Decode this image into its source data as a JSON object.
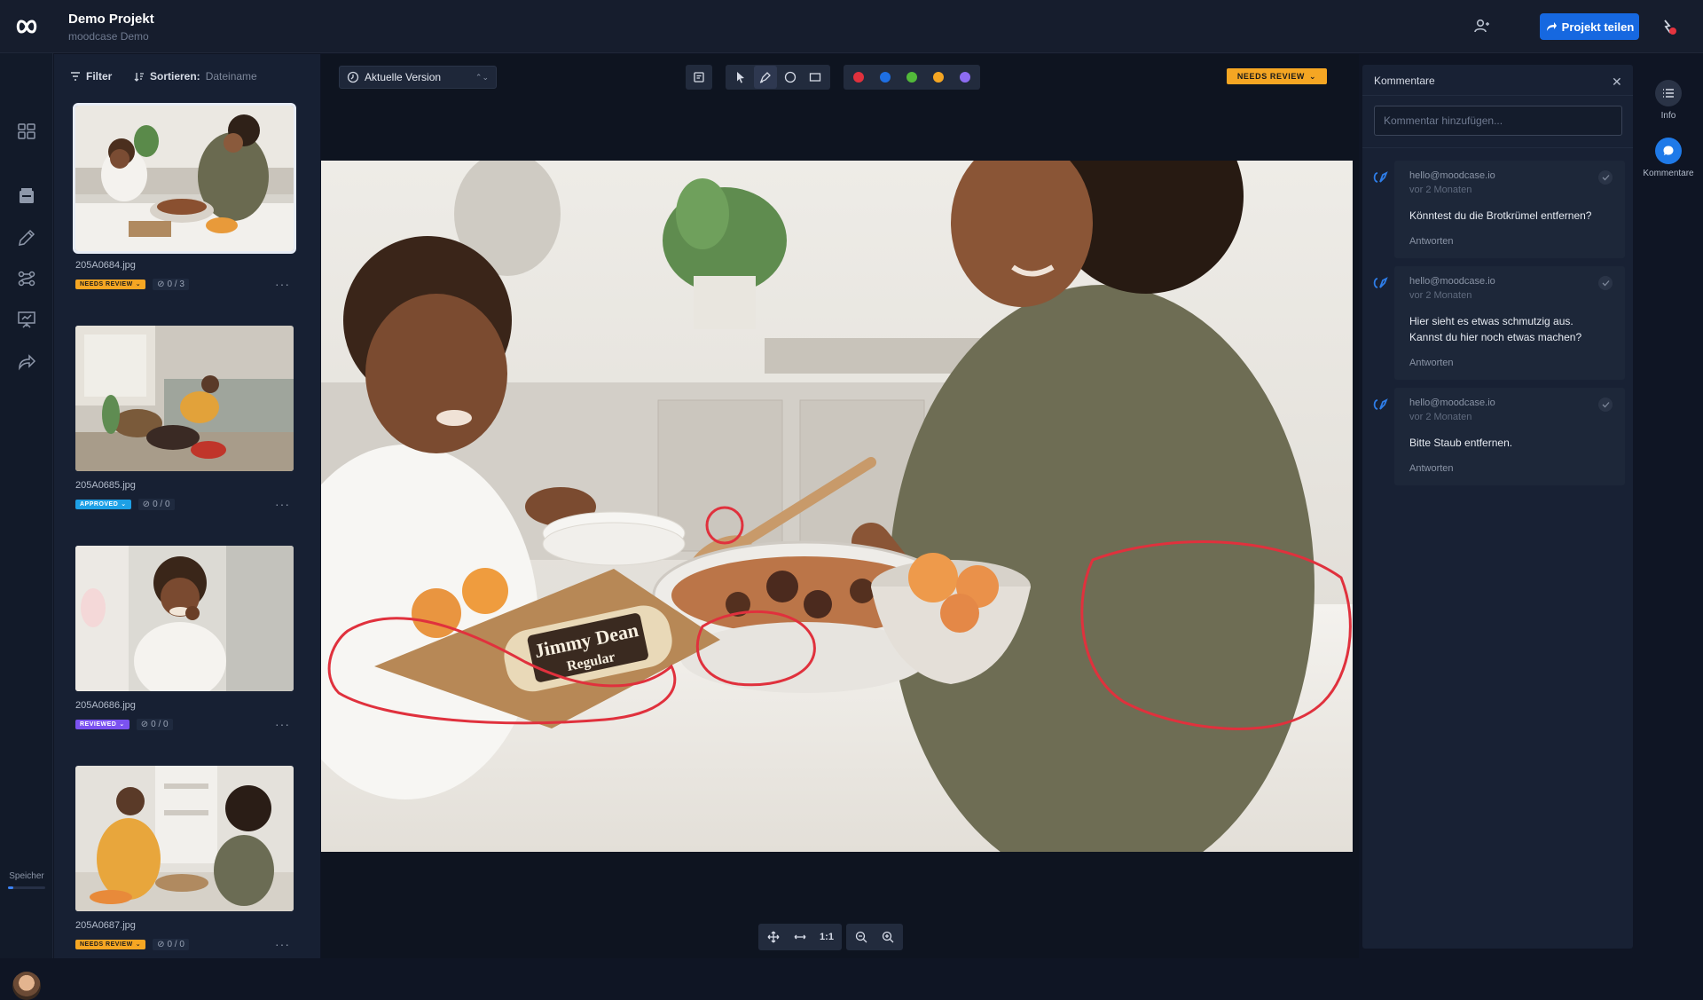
{
  "app": {
    "project_title": "Demo Projekt",
    "project_subtitle": "moodcase Demo",
    "share_label": "Projekt teilen"
  },
  "sidebar": {
    "storage_label": "Speicher",
    "storage_used_fraction": 0.15
  },
  "thumbs": {
    "filter_label": "Filter",
    "sort_label": "Sortieren:",
    "sort_value": "Dateiname",
    "items": [
      {
        "name": "205A0684.jpg",
        "status": "NEEDS REVIEW",
        "count": "0 / 3",
        "selected": true
      },
      {
        "name": "205A0685.jpg",
        "status": "APPROVED",
        "count": "0 / 0",
        "selected": false
      },
      {
        "name": "205A0686.jpg",
        "status": "REVIEWED",
        "count": "0 / 0",
        "selected": false
      },
      {
        "name": "205A0687.jpg",
        "status": "NEEDS REVIEW",
        "count": "0 / 0",
        "selected": false
      }
    ],
    "more_label": "···"
  },
  "viewer": {
    "version_label": "Aktuelle Version",
    "status_label": "NEEDS REVIEW",
    "colors": [
      "#e0313d",
      "#1e6fe3",
      "#52b93a",
      "#f5a623",
      "#8d6cf2"
    ],
    "fit_label": "1:1"
  },
  "comments": {
    "title": "Kommentare",
    "input_placeholder": "Kommentar hinzufügen...",
    "reply_label": "Antworten",
    "items": [
      {
        "author": "hello@moodcase.io",
        "time": "vor 2 Monaten",
        "text_lines": [
          "Könntest du die Brotkrümel entfernen?"
        ]
      },
      {
        "author": "hello@moodcase.io",
        "time": "vor 2 Monaten",
        "text_lines": [
          "Hier sieht es etwas schmutzig aus.",
          "Kannst du hier noch etwas machen?"
        ]
      },
      {
        "author": "hello@moodcase.io",
        "time": "vor 2 Monaten",
        "text_lines": [
          "Bitte Staub entfernen."
        ]
      }
    ]
  },
  "right_rail": {
    "info_label": "Info",
    "comments_label": "Kommentare"
  }
}
